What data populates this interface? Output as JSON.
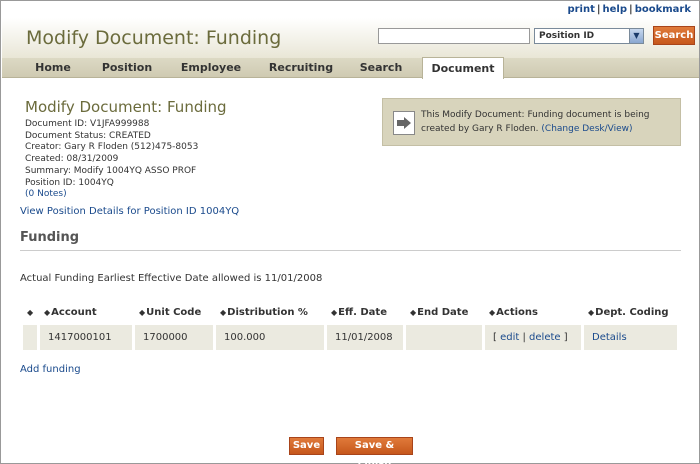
{
  "util_links": {
    "print": "print",
    "help": "help",
    "bookmark": "bookmark",
    "sep": "|"
  },
  "header": {
    "title": "Modify Document: Funding",
    "search_placeholder": "",
    "search_type": "Position ID",
    "search_button": "Search"
  },
  "tabs": [
    {
      "label": "Home"
    },
    {
      "label": "Position"
    },
    {
      "label": "Employee"
    },
    {
      "label": "Recruiting"
    },
    {
      "label": "Search"
    },
    {
      "label": "Document",
      "active": true
    }
  ],
  "document": {
    "title": "Modify Document: Funding",
    "id_line": "Document ID: V1JFA999988",
    "status_line": "Document Status: CREATED",
    "creator_line": "Creator: Gary R Floden (512)475-8053",
    "created_line": "Created: 08/31/2009",
    "summary_line": "Summary: Modify 1004YQ ASSO PROF",
    "position_line": "Position ID: 1004YQ",
    "notes_link": "(0 Notes)"
  },
  "notice": {
    "text": "This Modify Document: Funding document is being created by Gary R Floden.",
    "link": "(Change Desk/View)"
  },
  "view_position_link": "View Position Details for Position ID 1004YQ",
  "section": {
    "title": "Funding"
  },
  "earliest_text": "Actual Funding Earliest Effective Date allowed is 11/01/2008",
  "table": {
    "sort_glyph": "◆",
    "headers": [
      "",
      "Account",
      "Unit Code",
      "Distribution %",
      "Eff. Date",
      "End Date",
      "Actions",
      "Dept. Coding"
    ],
    "rows": [
      {
        "account": "1417000101",
        "unit_code": "1700000",
        "distribution": "100.000",
        "eff_date": "11/01/2008",
        "end_date": "",
        "bracket_open": "[",
        "edit": "edit",
        "pipe": "|",
        "delete": "delete",
        "bracket_close": "]",
        "details": "Details"
      }
    ]
  },
  "add_funding": "Add funding",
  "buttons": {
    "save": "Save",
    "save_finish": "Save & Finish"
  },
  "colors": {
    "accent": "#c6571c",
    "link": "#1a4a8c",
    "title": "#6b6b3c",
    "tabbar": "#d6d2bc"
  }
}
